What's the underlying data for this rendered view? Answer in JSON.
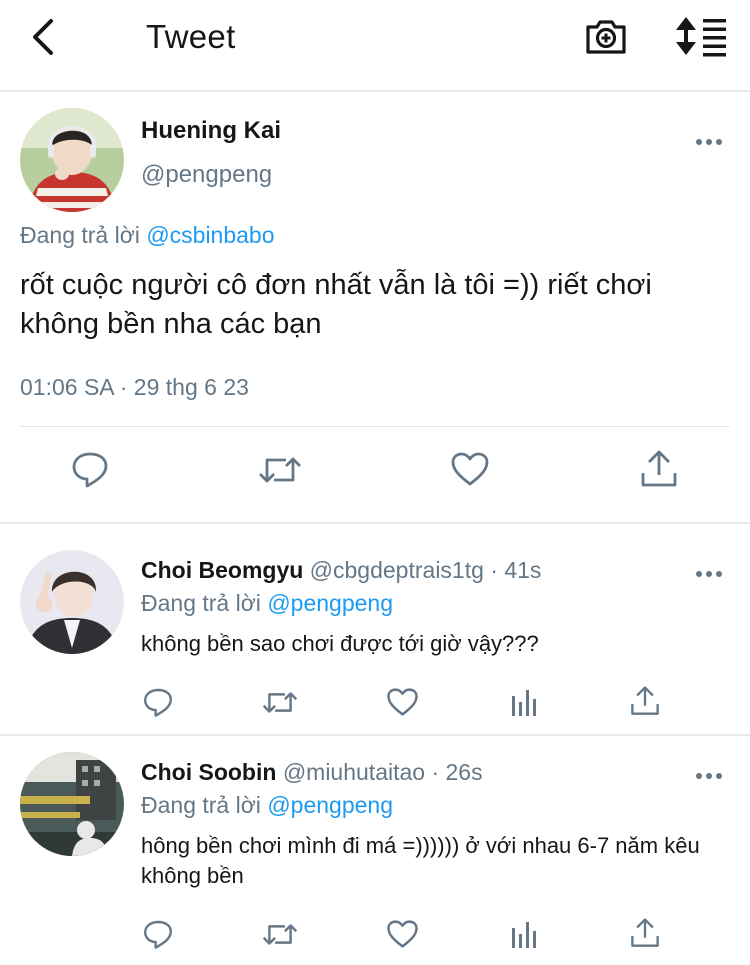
{
  "header": {
    "title": "Tweet",
    "back_icon": "chevron-left-icon",
    "camera_icon": "camera-add-icon",
    "sort_icon": "sort-list-icon"
  },
  "main_tweet": {
    "author_name": "Huening Kai",
    "author_handle": "@pengpeng",
    "reply_prefix": "Đang trả lời",
    "reply_to": "@csbinbabo",
    "text": "rốt cuộc người cô đơn nhất vẫn là tôi =)) riết chơi không bền nha các bạn",
    "timestamp": "01:06 SA · 29 thg 6 23",
    "actions": [
      "reply-icon",
      "retweet-icon",
      "like-icon",
      "share-icon"
    ]
  },
  "replies": [
    {
      "author_name": "Choi Beomgyu",
      "meta": "@cbgdeptrais1tg · 41s",
      "reply_prefix": "Đang trả lời",
      "reply_to": "@pengpeng",
      "text": "không bền sao chơi được tới giờ vậy???"
    },
    {
      "author_name": "Choi Soobin",
      "meta": "@miuhutaitao · 26s",
      "reply_prefix": "Đang trả lời",
      "reply_to": "@pengpeng",
      "text": "hông bền chơi mình đi má =)))))) ở với nhau 6-7 năm kêu không bền"
    }
  ],
  "colors": {
    "text": "#14171a",
    "secondary": "#657786",
    "link": "#1d9bf0",
    "divider": "#e6e9ec"
  }
}
